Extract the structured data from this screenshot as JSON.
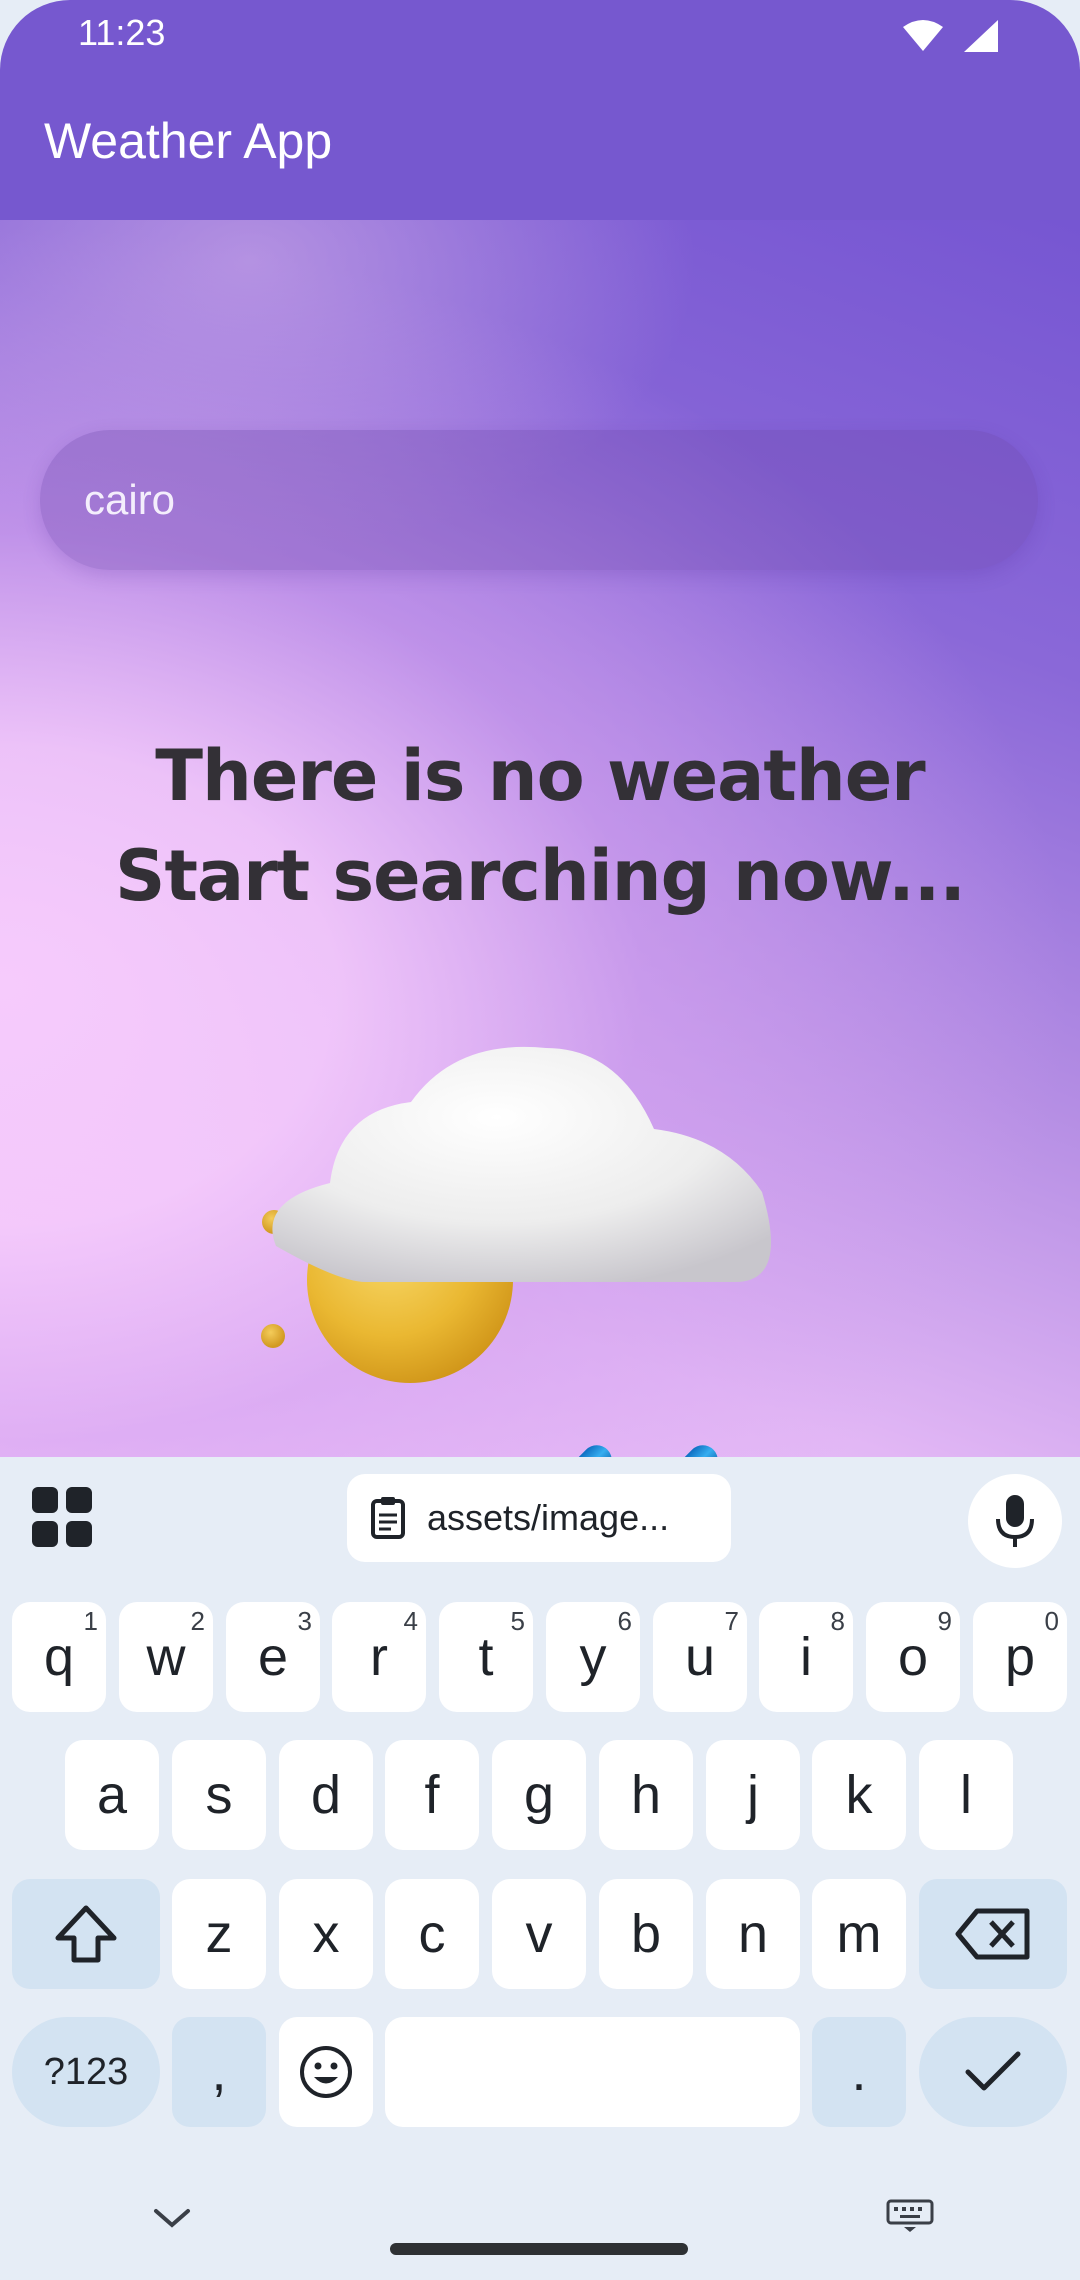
{
  "status_bar": {
    "time": "11:23",
    "icons": [
      "wifi-icon",
      "cell-signal-icon"
    ]
  },
  "app_bar": {
    "title": "Weather App"
  },
  "search": {
    "value": "cairo"
  },
  "message": {
    "line1": "There is no weather",
    "line2": "Start searching now..."
  },
  "illustration": {
    "name": "sun-cloud-rain-image"
  },
  "keyboard": {
    "toolbar": {
      "clipboard_text": "assets/image..."
    },
    "row1": [
      {
        "label": "q",
        "hint": "1"
      },
      {
        "label": "w",
        "hint": "2"
      },
      {
        "label": "e",
        "hint": "3"
      },
      {
        "label": "r",
        "hint": "4"
      },
      {
        "label": "t",
        "hint": "5"
      },
      {
        "label": "y",
        "hint": "6"
      },
      {
        "label": "u",
        "hint": "7"
      },
      {
        "label": "i",
        "hint": "8"
      },
      {
        "label": "o",
        "hint": "9"
      },
      {
        "label": "p",
        "hint": "0"
      }
    ],
    "row2": [
      "a",
      "s",
      "d",
      "f",
      "g",
      "h",
      "j",
      "k",
      "l"
    ],
    "row3": [
      "z",
      "x",
      "c",
      "v",
      "b",
      "n",
      "m"
    ],
    "row4": {
      "symbols": "?123",
      "comma": ",",
      "period": "."
    }
  },
  "colors": {
    "app_bar": "#7658cf",
    "keyboard_bg": "#e6edf6",
    "key_modifier": "#d3e3f2",
    "message_text": "#333036"
  }
}
